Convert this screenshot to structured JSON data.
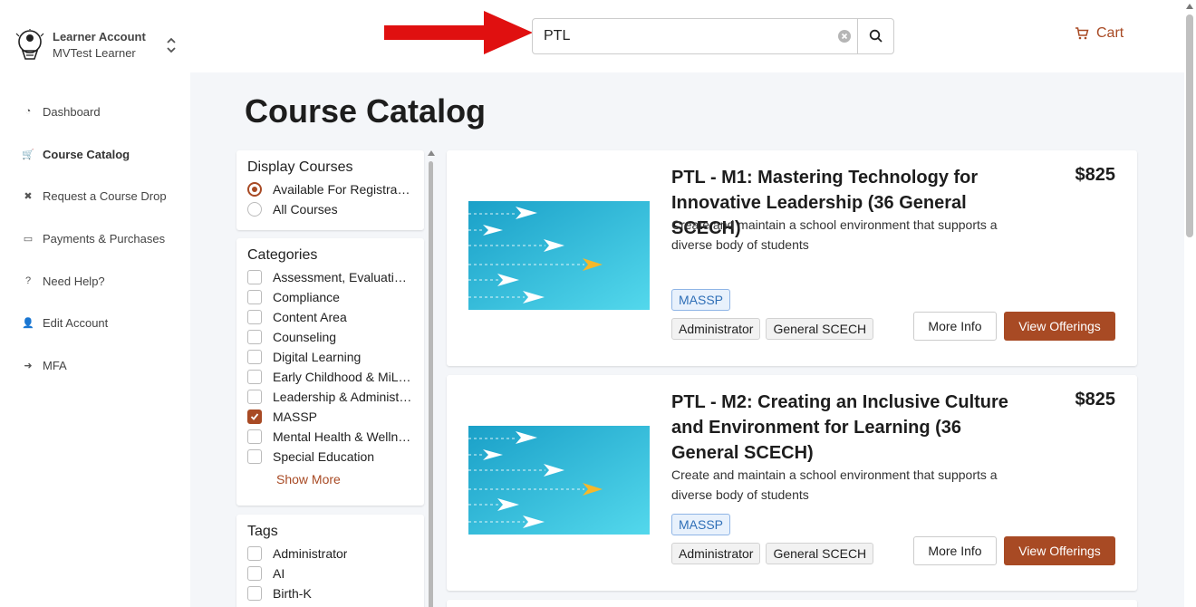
{
  "account": {
    "title": "Learner Account",
    "user": "MVTest Learner"
  },
  "nav": [
    {
      "label": "Dashboard",
      "icon": "pie-chart-icon",
      "glyph": "◔",
      "active": false
    },
    {
      "label": "Course Catalog",
      "icon": "cart-icon",
      "glyph": "🛒",
      "active": true
    },
    {
      "label": "Request a Course Drop",
      "icon": "x-icon",
      "glyph": "✖",
      "active": false
    },
    {
      "label": "Payments & Purchases",
      "icon": "credit-card-icon",
      "glyph": "▭",
      "active": false
    },
    {
      "label": "Need Help?",
      "icon": "question-icon",
      "glyph": "?",
      "active": false
    },
    {
      "label": "Edit Account",
      "icon": "user-icon",
      "glyph": "👤",
      "active": false
    },
    {
      "label": "MFA",
      "icon": "sign-in-icon",
      "glyph": "➜",
      "active": false
    }
  ],
  "search": {
    "value": "PTL"
  },
  "cart": {
    "label": "Cart"
  },
  "page": {
    "title": "Course Catalog"
  },
  "filters": {
    "display": {
      "title": "Display Courses",
      "options": [
        {
          "label": "Available For Registration",
          "selected": true
        },
        {
          "label": "All Courses",
          "selected": false
        }
      ]
    },
    "categories": {
      "title": "Categories",
      "items": [
        {
          "label": "Assessment, Evaluation & Research",
          "checked": false
        },
        {
          "label": "Compliance",
          "checked": false
        },
        {
          "label": "Content Area",
          "checked": false
        },
        {
          "label": "Counseling",
          "checked": false
        },
        {
          "label": "Digital Learning",
          "checked": false
        },
        {
          "label": "Early Childhood & MiLEAP",
          "checked": false
        },
        {
          "label": "Leadership & Administration",
          "checked": false
        },
        {
          "label": "MASSP",
          "checked": true
        },
        {
          "label": "Mental Health & Wellness",
          "checked": false
        },
        {
          "label": "Special Education",
          "checked": false
        }
      ],
      "show_more": "Show More"
    },
    "tags": {
      "title": "Tags",
      "items": [
        {
          "label": "Administrator",
          "checked": false
        },
        {
          "label": "AI",
          "checked": false
        },
        {
          "label": "Birth-K",
          "checked": false
        }
      ]
    }
  },
  "courses": [
    {
      "title": "PTL - M1: Mastering Technology for Innovative Leadership (36 General SCECH)",
      "price": "$825",
      "description": "Create and maintain a school environment that supports a diverse body of students",
      "badge": "MASSP",
      "tags": [
        "Administrator",
        "General SCECH"
      ],
      "more_info": "More Info",
      "view_offerings": "View Offerings"
    },
    {
      "title": "PTL - M2: Creating an Inclusive Culture and Environment for Learning (36 General SCECH)",
      "price": "$825",
      "description": "Create and maintain a school environment that supports a diverse body of students",
      "badge": "MASSP",
      "tags": [
        "Administrator",
        "General SCECH"
      ],
      "more_info": "More Info",
      "view_offerings": "View Offerings"
    }
  ],
  "colors": {
    "accent": "#a84a24",
    "badge_blue": "#2f6fb7",
    "arrow": "#e01010"
  }
}
